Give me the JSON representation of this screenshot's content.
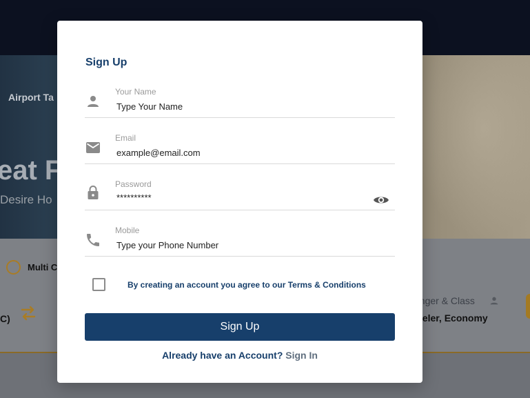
{
  "background": {
    "nav_item": "Airport Ta",
    "headline": "eat F",
    "subheadline": "Desire Ho",
    "trip_option": "Multi C",
    "origin_suffix": "C)",
    "class_label": "enger & Class",
    "class_value": "veler, Economy",
    "icons": [
      "swap-icon",
      "person-icon",
      "radio-button"
    ]
  },
  "modal": {
    "title": "Sign Up",
    "fields": [
      {
        "label": "Your Name",
        "placeholder": "Type Your Name",
        "icon": "person-icon"
      },
      {
        "label": "Email",
        "placeholder": "example@email.com",
        "icon": "mail-icon"
      },
      {
        "label": "Password",
        "placeholder": "**********",
        "icon": "lock-icon",
        "toggle_icon": "eye-icon"
      },
      {
        "label": "Mobile",
        "placeholder": "Type your Phone Number",
        "icon": "phone-icon"
      }
    ],
    "agree": {
      "text": "By creating an account you agree to our ",
      "link": "Terms & Conditions",
      "checked": false
    },
    "submit_label": "Sign Up",
    "signin_prompt": "Already have an Account?",
    "signin_link": "Sign In"
  },
  "colors": {
    "primary": "#173f6b",
    "accent": "#a97c25",
    "icon_gray": "#8a8a8a"
  }
}
